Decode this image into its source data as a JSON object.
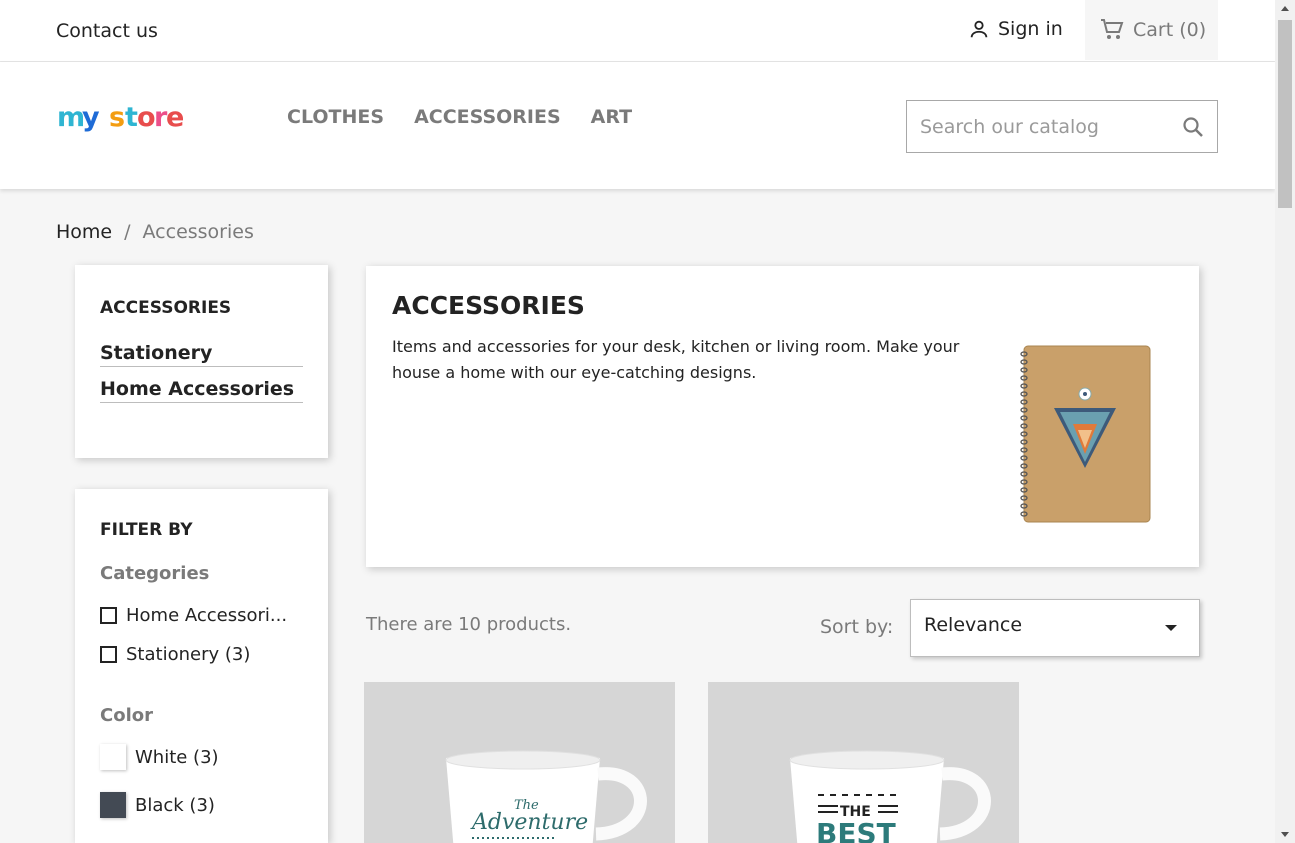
{
  "topbar": {
    "contact_label": "Contact us",
    "signin_label": "Sign in",
    "cart_label": "Cart (0)"
  },
  "header": {
    "logo_text": "my store",
    "nav": [
      "CLOTHES",
      "ACCESSORIES",
      "ART"
    ],
    "search_placeholder": "Search our catalog"
  },
  "breadcrumb": {
    "home": "Home",
    "separator": "/",
    "current": "Accessories"
  },
  "category_block": {
    "title": "ACCESSORIES",
    "items": [
      "Stationery",
      "Home Accessories"
    ]
  },
  "filters": {
    "title": "FILTER BY",
    "categories_label": "Categories",
    "categories": [
      "Home Accessori...",
      "Stationery (3)"
    ],
    "color_label": "Color",
    "colors": [
      {
        "label": "White (3)",
        "color": "#ffffff"
      },
      {
        "label": "Black (3)",
        "color": "#434a54"
      }
    ]
  },
  "banner": {
    "title": "ACCESSORIES",
    "description": "Items and accessories for your desk, kitchen or living room. Make your house a home with our eye-catching designs."
  },
  "listing": {
    "count_text": "There are 10 products.",
    "sort_label": "Sort by:",
    "sort_value": "Relevance"
  },
  "products": [
    {
      "mug_line1": "The",
      "mug_line2": "Adventure"
    },
    {
      "mug_line1": "THE",
      "mug_line2": "BEST"
    }
  ],
  "colors": {
    "logo_m": "#2fb5d2",
    "accent": "#2fb5d2",
    "mug_text": "#2d6b6b"
  }
}
